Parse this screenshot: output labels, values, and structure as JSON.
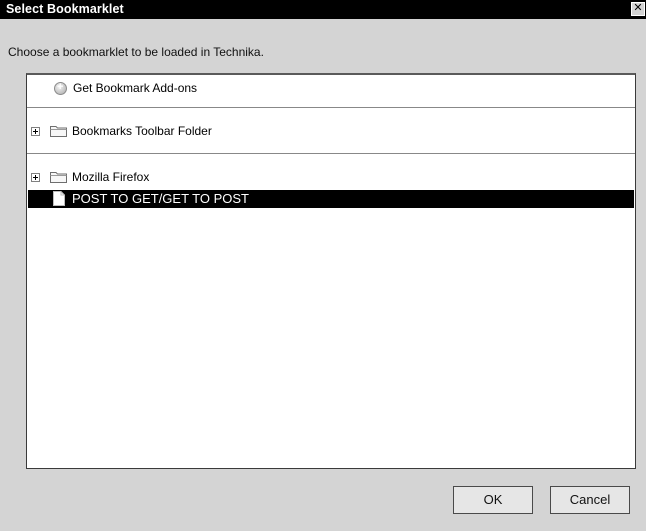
{
  "window": {
    "title": "Select Bookmarklet",
    "close_glyph": "✕"
  },
  "instruction": "Choose a bookmarklet to be loaded in Technika.",
  "tree": {
    "items": [
      {
        "label": "Get Bookmark Add-ons",
        "icon": "addon-icon"
      },
      {
        "label": "Bookmarks Toolbar Folder",
        "icon": "folder-icon",
        "expandable": true
      },
      {
        "label": "Mozilla Firefox",
        "icon": "folder-icon",
        "expandable": true
      },
      {
        "label": "POST TO GET/GET TO POST",
        "icon": "page-icon",
        "selected": true
      }
    ]
  },
  "buttons": {
    "ok": "OK",
    "cancel": "Cancel"
  }
}
